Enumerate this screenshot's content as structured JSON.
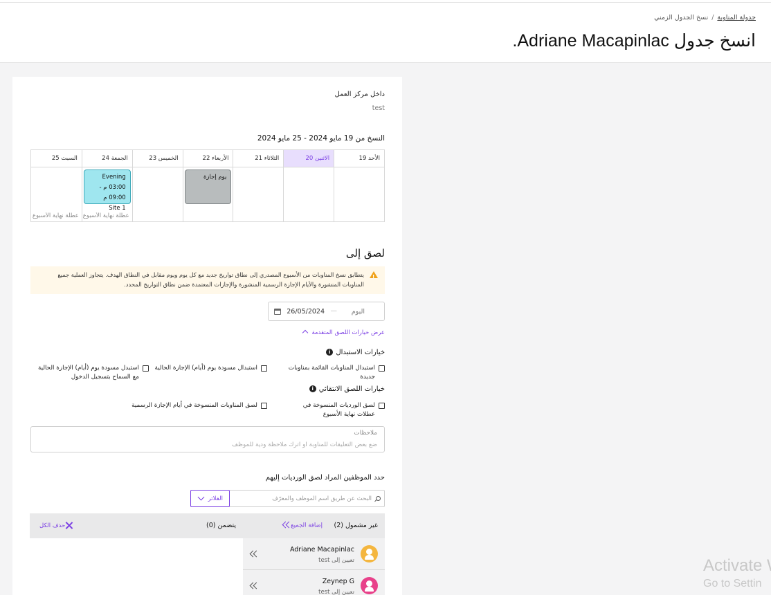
{
  "breadcrumb": {
    "parent": "جدولة المناوبة",
    "separator": "/",
    "current": "نسخ الجدول الزمني"
  },
  "page_title": "انسخ جدول Adriane Macapinlac.",
  "work_center": {
    "label": "داخل مركز العمل",
    "value": "test"
  },
  "copy_range": "النسخ من 19 مايو 2024 - 25 مايو 2024",
  "calendar": {
    "days": [
      {
        "label": "الأحد 19"
      },
      {
        "label": "الاثنين 20"
      },
      {
        "label": "الثلاثاء 21"
      },
      {
        "label": "الأربعاء 22"
      },
      {
        "label": "الخميس 23"
      },
      {
        "label": "الجمعة 24"
      },
      {
        "label": "السبت 25"
      }
    ],
    "holiday_label": "يوم إجازة",
    "shift": {
      "name": "Evening",
      "time": "03:00 م - 09:00 م",
      "site": "Site 1"
    },
    "weekend_label": "عطلة نهاية الأسبوع"
  },
  "paste": {
    "title": "لصق إلى",
    "alert_line1": "يتطابق نسخ المناوبات من الأسبوع المصدري إلى نطاق تواريخ جديد مع كل يوم ويوم مقابل في النطاق الهدف. يتجاوز العملية جميع",
    "alert_line2": "المناوبات المنشورة والأيام الإجازة الرسمية المنشورة والإجازات المعتمدة ضمن نطاق التواريخ المحدد.",
    "date_start": "اليوم",
    "date_end": "26/05/2024",
    "advanced_link": "عرض خيارات اللصق المتقدمة"
  },
  "replace_options": {
    "title": "خيارات الاستبدال",
    "opt1": "استبدال المناوبات القائمة بمناوبات جديدة",
    "opt2": "استبدال مسودة يوم (أيام) الإجازة الحالية",
    "opt3": "استبدل مسودة يوم (أيام) الإجازة الحالية مع السماح بتسجيل الدخول"
  },
  "smart_paste": {
    "title": "خيارات اللصق الانتقائي",
    "opt1": "لصق الورديات المنسوخة في عطلات نهاية الأسبوع",
    "opt2": "لصق المناوبات المنسوخة في أيام الإجازة الرسمية"
  },
  "notes": {
    "label": "ملاحظات",
    "placeholder": "ضع بعض التعليقات للمناوبة او اترك ملاحظة ودية للموظف"
  },
  "employees": {
    "title": "حدد الموظفين المراد لصق الورديات إليهم",
    "search_placeholder": "البحث عن طريق اسم الموظف والمعرّف",
    "filter_label": "الفلاتر",
    "excluded_title": "غير مشمول (2)",
    "add_all": "إضافة الجميع",
    "included_title": "يتضمن (0)",
    "remove_all": "حذف الكل",
    "list": [
      {
        "name": "Adriane Macapinlac",
        "sub": "تعيين إلى test",
        "color": "#f4b63f"
      },
      {
        "name": "Zeynep G",
        "sub": "تعيين إلى test",
        "color": "#e8418a"
      }
    ]
  },
  "watermark": {
    "line1": "Activate W",
    "line2": "Go to Settin"
  },
  "colors": {
    "accent": "#7b3fe4",
    "shift_bg": "#9fe6ef",
    "holiday_bg": "#b8bcbd",
    "alert_bg": "#fff8e9"
  }
}
